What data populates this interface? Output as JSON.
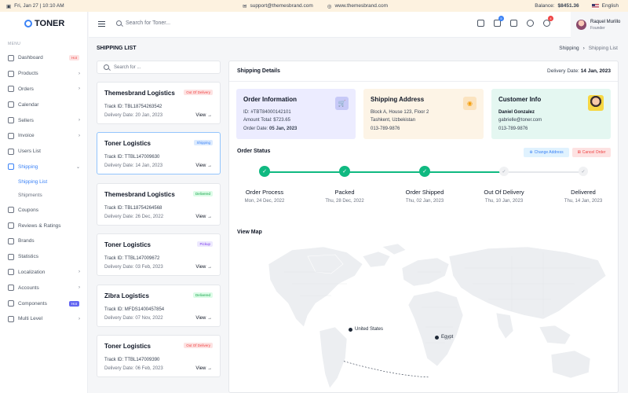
{
  "topbar": {
    "date": "Fri, Jan 27 | 10:10 AM",
    "email": "support@themesbrand.com",
    "website": "www.themesbrand.com",
    "balance_label": "Balance:",
    "balance_value": "$8451.36",
    "language": "English"
  },
  "brand": {
    "name": "TONER"
  },
  "sidebar": {
    "menu_label": "MENU",
    "items": [
      {
        "label": "Dashboard",
        "badge": "Hot"
      },
      {
        "label": "Products"
      },
      {
        "label": "Orders"
      },
      {
        "label": "Calendar"
      },
      {
        "label": "Sellers"
      },
      {
        "label": "Invoice"
      },
      {
        "label": "Users List"
      },
      {
        "label": "Shipping"
      },
      {
        "label": "Coupons"
      },
      {
        "label": "Reviews & Ratings"
      },
      {
        "label": "Brands"
      },
      {
        "label": "Statistics"
      },
      {
        "label": "Localization"
      },
      {
        "label": "Accounts"
      },
      {
        "label": "Components",
        "badge": "Hot"
      },
      {
        "label": "Multi Level"
      }
    ],
    "shipping_sub": [
      "Shipping List",
      "Shipments"
    ]
  },
  "header": {
    "search_placeholder": "Search for Toner...",
    "cart_count": "5",
    "notif_count": "4",
    "user_name": "Raquel Murillo",
    "user_role": "Founder"
  },
  "page": {
    "title": "SHIPPING LIST",
    "breadcrumb": [
      "Shipping",
      "Shipping List"
    ]
  },
  "list": {
    "search_placeholder": "Search for ...",
    "cards": [
      {
        "name": "Themesbrand Logistics",
        "status": "Out Of Delivery",
        "track": "Track ID: TBL18754263542",
        "date": "Delivery Date: 20 Jan, 2023",
        "view": "View →"
      },
      {
        "name": "Toner Logistics",
        "status": "Shipping",
        "track": "Track ID: TTBL147009630",
        "date": "Delivery Date: 14 Jan, 2023",
        "view": "View →"
      },
      {
        "name": "Themesbrand Logistics",
        "status": "Delivered",
        "track": "Track ID: TBL18754264568",
        "date": "Delivery Date: 26 Dec, 2022",
        "view": "View →"
      },
      {
        "name": "Toner Logistics",
        "status": "Pickup",
        "track": "Track ID: TTBL147009672",
        "date": "Delivery Date: 03 Feb, 2023",
        "view": "View →"
      },
      {
        "name": "Zibra Logistics",
        "status": "Delivered",
        "track": "Track ID: MFDS1400457854",
        "date": "Delivery Date: 07 Nov, 2022",
        "view": "View →"
      },
      {
        "name": "Toner Logistics",
        "status": "Out Of Delivery",
        "track": "Track ID: TTBL147009390",
        "date": "Delivery Date: 06 Feb, 2023",
        "view": "View →"
      }
    ]
  },
  "details": {
    "title": "Shipping Details",
    "delivery_label": "Delivery Date:",
    "delivery_value": "14 Jan, 2023",
    "order_info": {
      "title": "Order Information",
      "id": "ID: #TBT84000142101",
      "amount": "Amount Total: $723.65",
      "date_label": "Order Date:",
      "date_value": "05 Jan, 2023"
    },
    "shipping_address": {
      "title": "Shipping Address",
      "line1": "Block A, House 123, Floor 2",
      "line2": "Tashkent, Uzbekistan",
      "phone": "013-789-9876"
    },
    "customer": {
      "title": "Customer Info",
      "name": "Daniel Gonzalez",
      "email": "gabrielle@toner.com",
      "phone": "013-789-9876"
    },
    "order_status_title": "Order Status",
    "change_address": "Change Address",
    "cancel_order": "Cancel Order",
    "steps": [
      {
        "name": "Order Process",
        "date": "Mon, 24 Dec, 2022",
        "done": true
      },
      {
        "name": "Packed",
        "date": "Thu, 28 Dec, 2022",
        "done": true
      },
      {
        "name": "Order Shipped",
        "date": "Thu, 02 Jan, 2023",
        "done": true
      },
      {
        "name": "Out Of Delivery",
        "date": "Thu, 10 Jan, 2023",
        "done": false
      },
      {
        "name": "Delivered",
        "date": "Thu, 14 Jan, 2023",
        "done": false
      }
    ],
    "map_title": "View Map",
    "map_markers": [
      "United States",
      "Egypt"
    ]
  },
  "colors": {
    "accent": "#3b82f6",
    "success": "#10b981",
    "danger": "#ef4444"
  }
}
